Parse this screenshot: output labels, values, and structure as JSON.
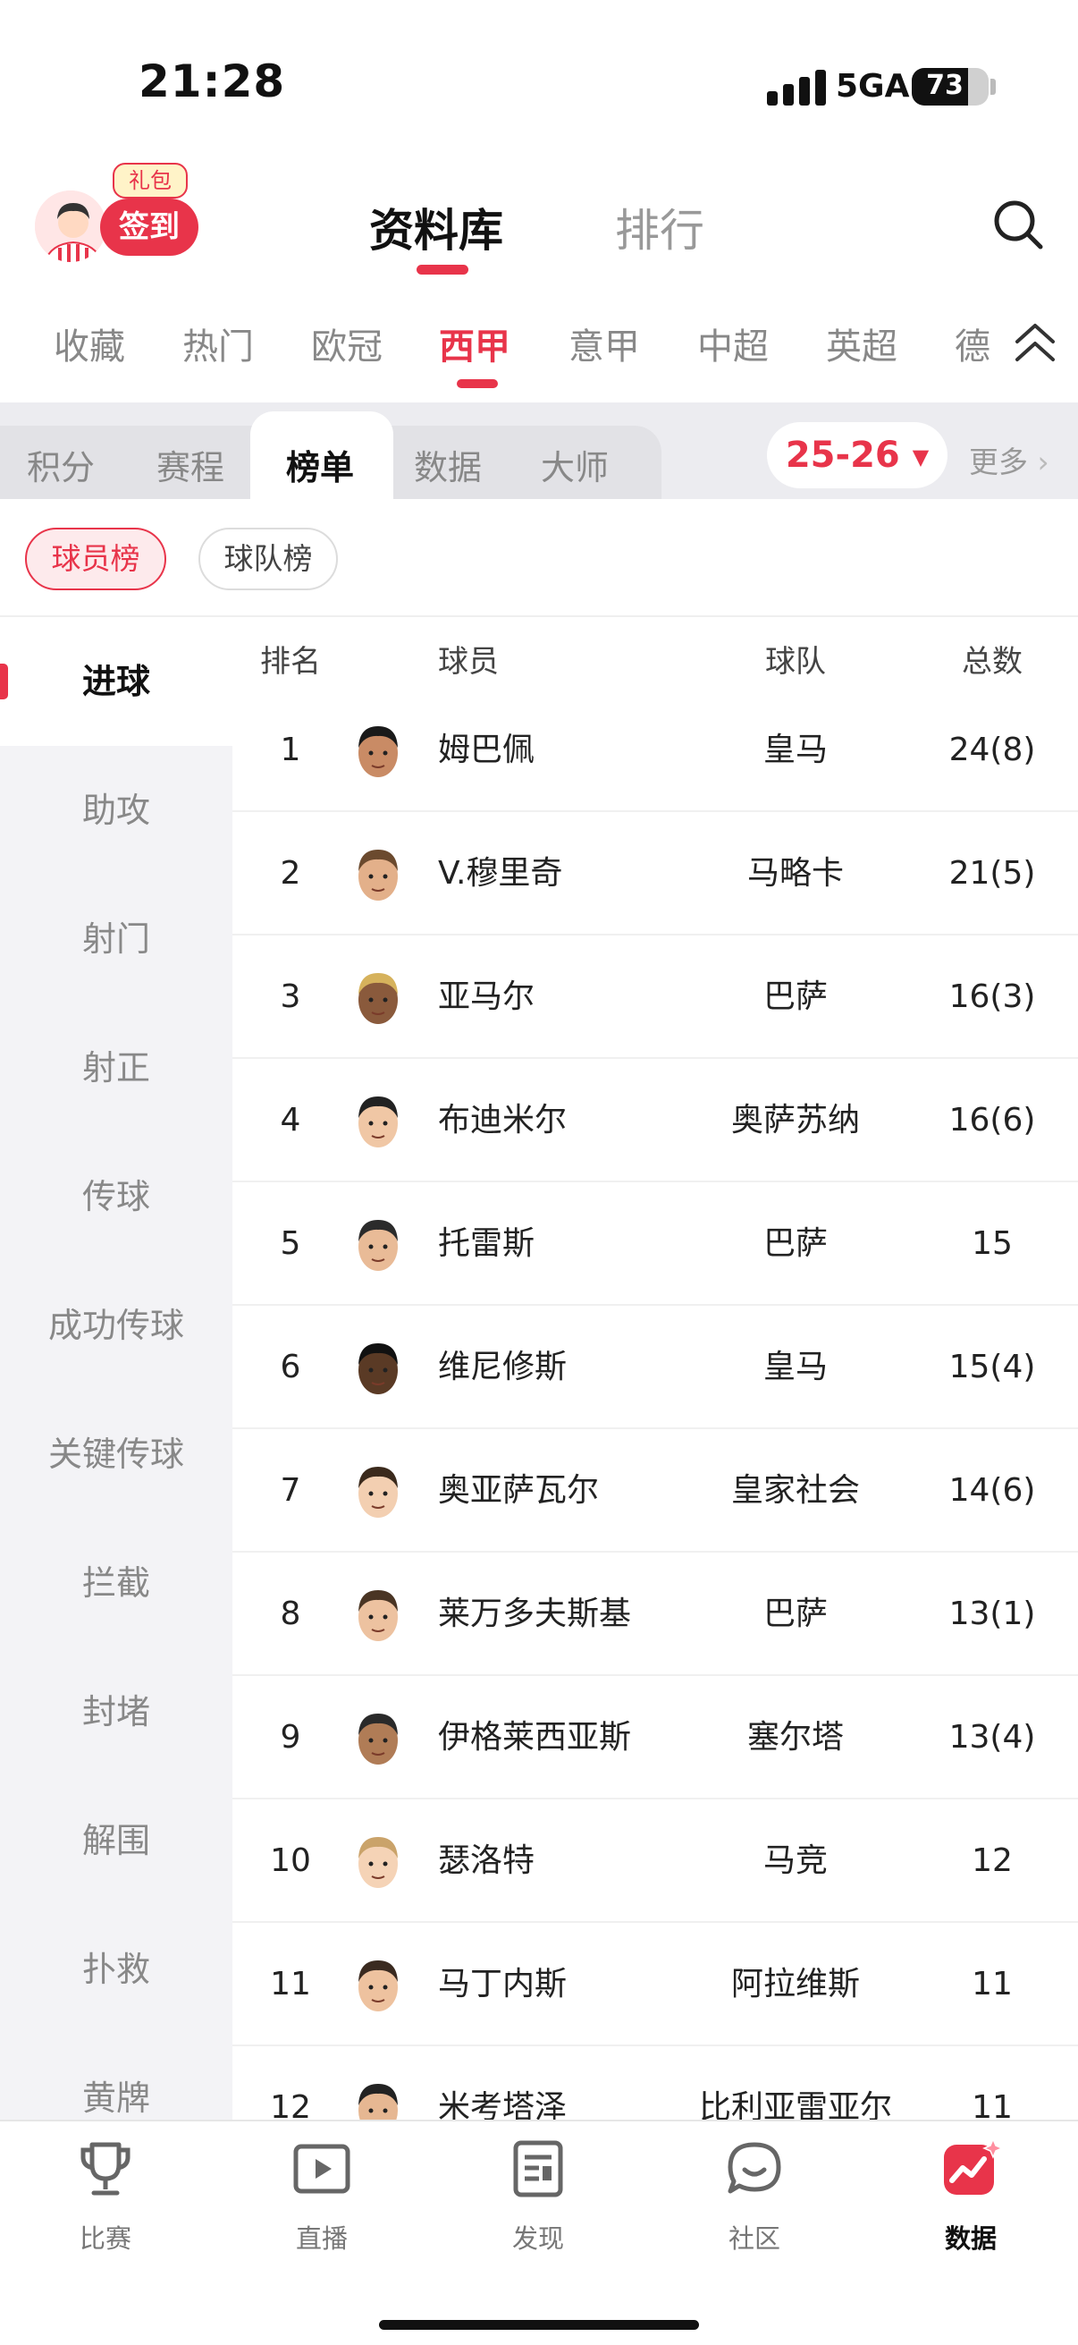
{
  "status_bar": {
    "time": "21:28",
    "network": "5GA",
    "battery": "73",
    "battery_level": 0.73
  },
  "header": {
    "gift_badge": "礼包",
    "checkin_label": "签到",
    "tabs": [
      {
        "label": "资料库",
        "active": true
      },
      {
        "label": "排行",
        "active": false
      }
    ],
    "search_icon": "search-icon"
  },
  "leagues": [
    "收藏",
    "热门",
    "欧冠",
    "西甲",
    "意甲",
    "中超",
    "英超",
    "德"
  ],
  "active_league": "西甲",
  "sub_tabs": [
    "积分",
    "赛程",
    "榜单",
    "数据",
    "大师"
  ],
  "active_sub_tab": "榜单",
  "season": "25-26",
  "more_label": "更多",
  "rank_types": [
    "球员榜",
    "球队榜"
  ],
  "categories": [
    "进球",
    "助攻",
    "射门",
    "射正",
    "传球",
    "成功传球",
    "关键传球",
    "拦截",
    "封堵",
    "解围",
    "扑救",
    "黄牌"
  ],
  "table": {
    "headers": {
      "rank": "排名",
      "player": "球员",
      "team": "球队",
      "total": "总数"
    },
    "rows": [
      {
        "rank": "1",
        "player": "姆巴佩",
        "team": "皇马",
        "total": "24(8)"
      },
      {
        "rank": "2",
        "player": "V.穆里奇",
        "team": "马略卡",
        "total": "21(5)"
      },
      {
        "rank": "3",
        "player": "亚马尔",
        "team": "巴萨",
        "total": "16(3)"
      },
      {
        "rank": "4",
        "player": "布迪米尔",
        "team": "奥萨苏纳",
        "total": "16(6)"
      },
      {
        "rank": "5",
        "player": "托雷斯",
        "team": "巴萨",
        "total": "15"
      },
      {
        "rank": "6",
        "player": "维尼修斯",
        "team": "皇马",
        "total": "15(4)"
      },
      {
        "rank": "7",
        "player": "奥亚萨瓦尔",
        "team": "皇家社会",
        "total": "14(6)"
      },
      {
        "rank": "8",
        "player": "莱万多夫斯基",
        "team": "巴萨",
        "total": "13(1)"
      },
      {
        "rank": "9",
        "player": "伊格莱西亚斯",
        "team": "塞尔塔",
        "total": "13(4)"
      },
      {
        "rank": "10",
        "player": "瑟洛特",
        "team": "马竞",
        "total": "12"
      },
      {
        "rank": "11",
        "player": "马丁内斯",
        "team": "阿拉维斯",
        "total": "11"
      },
      {
        "rank": "12",
        "player": "米考塔泽",
        "team": "比利亚雷亚尔",
        "total": "11"
      }
    ]
  },
  "bottom_nav": [
    {
      "label": "比赛",
      "icon": "trophy-icon"
    },
    {
      "label": "直播",
      "icon": "play-icon"
    },
    {
      "label": "发现",
      "icon": "document-icon"
    },
    {
      "label": "社区",
      "icon": "chat-bubble-icon"
    },
    {
      "label": "数据",
      "icon": "data-chart-icon",
      "active": true
    }
  ],
  "colors": {
    "accent": "#e8344a",
    "inactive_text": "#888888",
    "sidebar_bg": "#f3f3f6"
  }
}
